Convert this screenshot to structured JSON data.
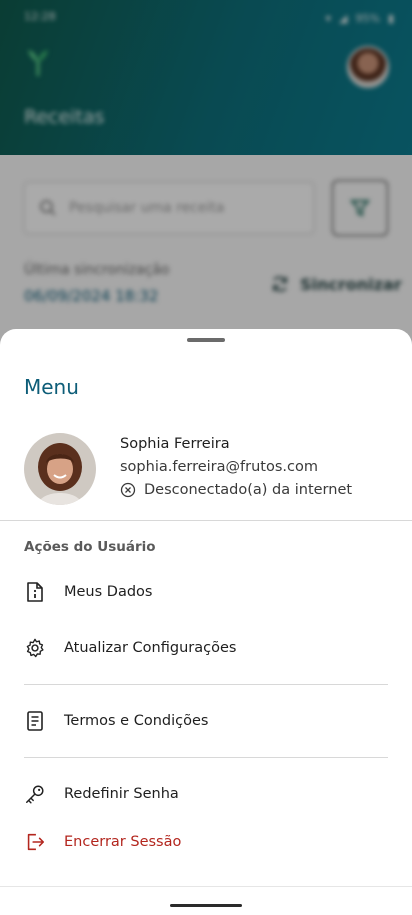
{
  "statusbar": {
    "time": "12:28",
    "battery": "95%"
  },
  "app": {
    "page_title": "Receitas",
    "search_placeholder": "Pesquisar uma receita",
    "sync_label": "Última sincronização",
    "sync_date": "06/09/2024 18:32",
    "sync_button": "Sincronizar"
  },
  "menu": {
    "title": "Menu",
    "user": {
      "name": "Sophia Ferreira",
      "email": "sophia.ferreira@frutos.com",
      "status": "Desconectado(a) da internet"
    },
    "section_title": "Ações do Usuário",
    "items": [
      {
        "label": "Meus Dados",
        "icon": "info-document-icon"
      },
      {
        "label": "Atualizar Configurações",
        "icon": "gear-icon"
      },
      {
        "label": "Termos e Condições",
        "icon": "document-icon"
      },
      {
        "label": "Redefinir Senha",
        "icon": "key-icon"
      },
      {
        "label": "Encerrar Sessão",
        "icon": "logout-icon"
      }
    ]
  },
  "colors": {
    "accent": "#0d5d78",
    "danger": "#b3261e",
    "header_start": "#0f5a4c",
    "header_end": "#0c7b8e"
  }
}
